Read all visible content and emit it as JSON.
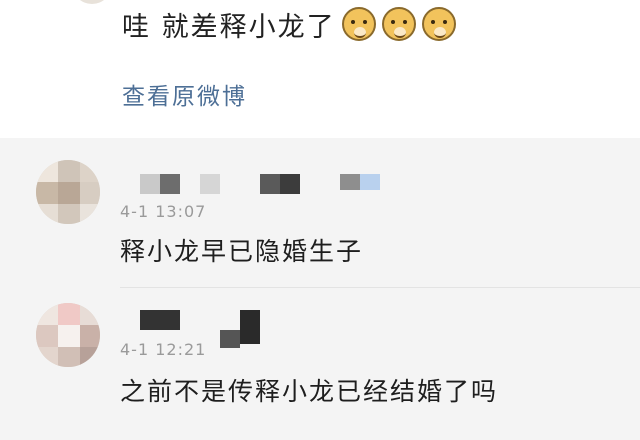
{
  "post": {
    "text": "哇 就差释小龙了",
    "emojis": [
      "doge-icon",
      "doge-icon",
      "doge-icon"
    ],
    "view_original": "查看原微博"
  },
  "comments": [
    {
      "username": "",
      "time": "4-1 13:07",
      "text": "释小龙早已隐婚生子"
    },
    {
      "username": "",
      "time": "4-1 12:21",
      "text": "之前不是传释小龙已经结婚了吗"
    }
  ],
  "colors": {
    "link": "#4d6f96",
    "comments_bg": "#f4f4f4",
    "meta_text": "#9a9a9a"
  }
}
